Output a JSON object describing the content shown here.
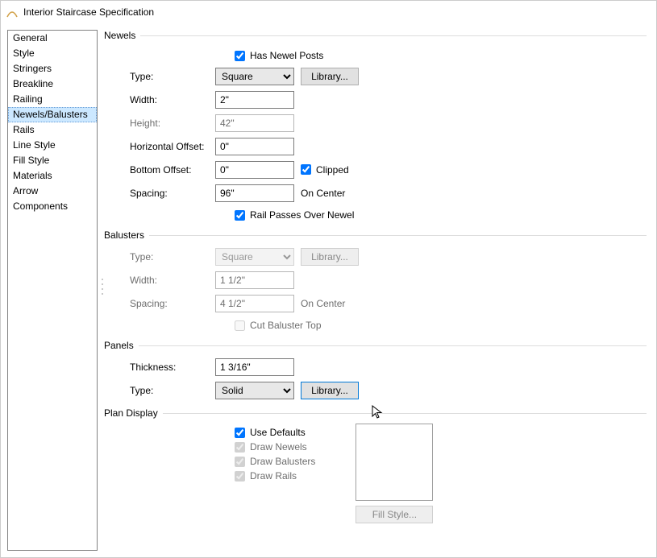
{
  "window": {
    "title": "Interior Staircase Specification"
  },
  "sidebar": {
    "items": [
      {
        "label": "General"
      },
      {
        "label": "Style"
      },
      {
        "label": "Stringers"
      },
      {
        "label": "Breakline"
      },
      {
        "label": "Railing"
      },
      {
        "label": "Newels/Balusters"
      },
      {
        "label": "Rails"
      },
      {
        "label": "Line Style"
      },
      {
        "label": "Fill Style"
      },
      {
        "label": "Materials"
      },
      {
        "label": "Arrow"
      },
      {
        "label": "Components"
      }
    ],
    "selected_index": 5
  },
  "groups": {
    "newels": {
      "title": "Newels",
      "has_newel_posts": {
        "label": "Has Newel Posts",
        "checked": true
      },
      "type": {
        "label": "Type:",
        "value": "Square",
        "library_btn": "Library..."
      },
      "width": {
        "label": "Width:",
        "value": "2\""
      },
      "height": {
        "label": "Height:",
        "value": "42\""
      },
      "hoffset": {
        "label": "Horizontal Offset:",
        "value": "0\""
      },
      "boffset": {
        "label": "Bottom Offset:",
        "value": "0\"",
        "clipped_label": "Clipped",
        "clipped_checked": true
      },
      "spacing": {
        "label": "Spacing:",
        "value": "96\"",
        "suffix": "On Center"
      },
      "rail_passes": {
        "label": "Rail Passes Over Newel",
        "checked": true
      }
    },
    "balusters": {
      "title": "Balusters",
      "type": {
        "label": "Type:",
        "value": "Square",
        "library_btn": "Library..."
      },
      "width": {
        "label": "Width:",
        "value": "1 1/2\""
      },
      "spacing": {
        "label": "Spacing:",
        "value": "4 1/2\"",
        "suffix": "On Center"
      },
      "cut_top": {
        "label": "Cut Baluster Top",
        "checked": false
      }
    },
    "panels": {
      "title": "Panels",
      "thickness": {
        "label": "Thickness:",
        "value": "1 3/16\""
      },
      "type": {
        "label": "Type:",
        "value": "Solid",
        "library_btn": "Library..."
      }
    },
    "plan": {
      "title": "Plan Display",
      "use_defaults": {
        "label": "Use Defaults",
        "checked": true
      },
      "draw_newels": {
        "label": "Draw Newels",
        "checked": true
      },
      "draw_balusters": {
        "label": "Draw Balusters",
        "checked": true
      },
      "draw_rails": {
        "label": "Draw Rails",
        "checked": true
      },
      "fill_style_btn": "Fill Style..."
    }
  }
}
